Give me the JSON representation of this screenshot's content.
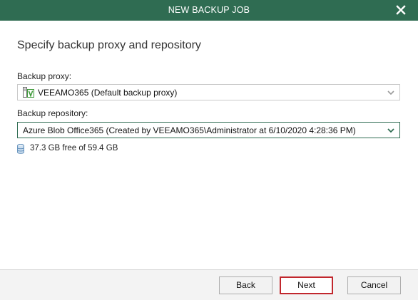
{
  "window": {
    "title": "NEW BACKUP JOB",
    "close_icon": "close-icon"
  },
  "page": {
    "heading": "Specify backup proxy and repository"
  },
  "proxy": {
    "label": "Backup proxy:",
    "value": "VEEAMO365 (Default backup proxy)",
    "icon": "server-icon"
  },
  "repository": {
    "label": "Backup repository:",
    "value": "Azure Blob Office365 (Created by VEEAMO365\\Administrator at 6/10/2020 4:28:36 PM)",
    "free_space": "37.3 GB free of 59.4 GB",
    "icon": "database-icon"
  },
  "buttons": {
    "back": "Back",
    "next": "Next",
    "cancel": "Cancel"
  },
  "colors": {
    "titlebar": "#2f6c52",
    "focus_border": "#2f6c52",
    "highlight": "#c1272d"
  }
}
